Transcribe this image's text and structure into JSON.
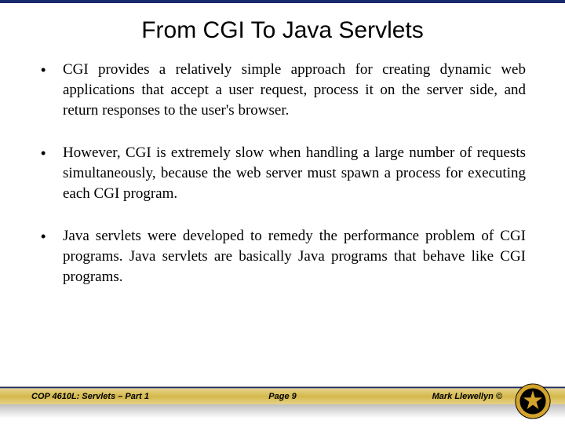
{
  "title": "From CGI To Java Servlets",
  "bullets": [
    "CGI provides a relatively simple approach for creating dynamic web applications that accept a user request, process it on the server side, and return responses to the user's browser.",
    "However, CGI is extremely slow when handling a large number of requests simultaneously, because the web server must spawn a process for executing each CGI program.",
    "Java servlets were developed to remedy the performance problem of CGI programs.  Java servlets are basically Java programs that behave like CGI programs."
  ],
  "footer": {
    "course": "COP 4610L: Servlets – Part 1",
    "page": "Page 9",
    "author": "Mark Llewellyn ©"
  }
}
